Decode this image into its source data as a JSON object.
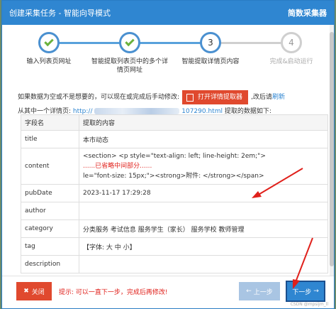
{
  "window": {
    "title": "创建采集任务 - 智能向导模式",
    "app_name": "简数采集器"
  },
  "steps": [
    {
      "number": "1",
      "label": "输入列表页网址",
      "state": "done"
    },
    {
      "number": "2",
      "label": "智能提取列表页中的多个详情页网址",
      "state": "done"
    },
    {
      "number": "3",
      "label": "智能提取详情页内容",
      "state": "active"
    },
    {
      "number": "4",
      "label": "完成&启动运行",
      "state": "pending"
    }
  ],
  "hint": {
    "text_before": "如果数据为空或不是想要的，可以现在或完成后手动修改:",
    "open_button": "打开详情提取器",
    "text_after": ",改后请",
    "refresh": "刷新",
    "line2_prefix": "从其中一个详情页:",
    "url_start": "http://",
    "url_end": "107290.html",
    "line2_suffix": " 提取的数据如下:"
  },
  "table": {
    "headers": [
      "字段名",
      "提取的内容"
    ],
    "rows": [
      {
        "key": "title",
        "value": "本市动态"
      },
      {
        "key": "content",
        "line1": "<section> <p style=\"text-align: left; line-height: 2em;\">",
        "line2": "......已省略中间部分......",
        "line3": "le=\"font-size: 15px;\"><strong>附件: </strong></span>"
      },
      {
        "key": "pubDate",
        "value": "2023-11-17 17:29:28"
      },
      {
        "key": "author",
        "value": ""
      },
      {
        "key": "category",
        "value": "分类服务 考试信息 服务学生（家长） 服务学校 教师管理"
      },
      {
        "key": "tag",
        "value": "【字体:  大  中  小】"
      },
      {
        "key": "description",
        "value": ""
      }
    ]
  },
  "footer": {
    "close_label": "关闭",
    "tip": "提示: 可以一直下一步，完成后再修改!",
    "prev_label": "上一步",
    "next_label": "下一步",
    "watermark": "CSDN @mpsijm_ll"
  },
  "colors": {
    "primary": "#2f86d1",
    "danger": "#e0492e",
    "success": "#6bb23d"
  }
}
